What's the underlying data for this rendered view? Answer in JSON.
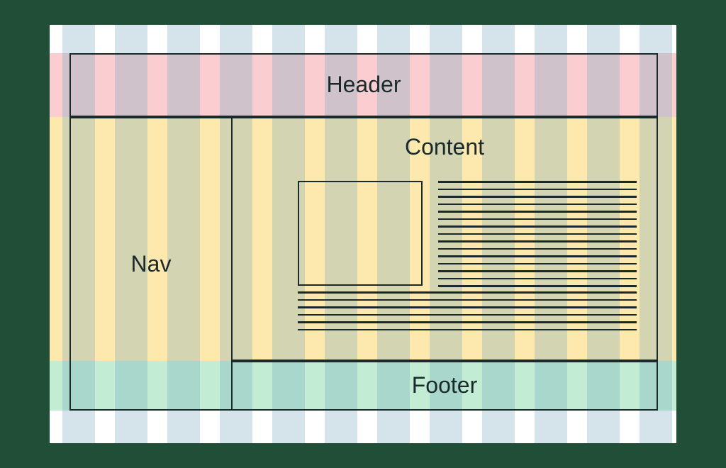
{
  "layout": {
    "header_label": "Header",
    "nav_label": "Nav",
    "content_label": "Content",
    "footer_label": "Footer"
  },
  "bands": {
    "top": "#f0646e",
    "middle": "#fac83c",
    "bottom": "#6ed296"
  },
  "columns_count": 12,
  "content_lines_upper": 15,
  "content_lines_lower": 6
}
